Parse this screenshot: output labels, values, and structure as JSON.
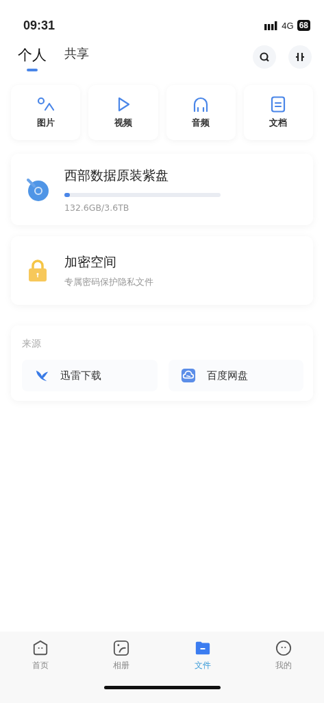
{
  "status_bar": {
    "time": "09:31",
    "network": "4G",
    "battery": "68"
  },
  "tabs": [
    {
      "label": "个人",
      "selected": true
    },
    {
      "label": "共享",
      "selected": false
    }
  ],
  "categories": [
    {
      "kind": "picture",
      "label": "图片"
    },
    {
      "kind": "video",
      "label": "视频"
    },
    {
      "kind": "audio",
      "label": "音频"
    },
    {
      "kind": "document",
      "label": "文档"
    }
  ],
  "drive": {
    "name": "西部数据原装紫盘",
    "level": 0.036,
    "usage": "132.6GB/3.6TB"
  },
  "vault": {
    "title": "加密空间",
    "subtitle": "专属密码保护隐私文件"
  },
  "sources": {
    "title": "来源",
    "items": [
      {
        "kind": "xunlei",
        "label": "迅雷下载"
      },
      {
        "kind": "baidu",
        "label": "百度网盘"
      }
    ]
  },
  "nav": [
    {
      "kind": "home",
      "label": "首页",
      "selected": false
    },
    {
      "kind": "album",
      "label": "相册",
      "selected": false
    },
    {
      "kind": "files",
      "label": "文件",
      "selected": true
    },
    {
      "kind": "mine",
      "label": "我的",
      "selected": false
    }
  ]
}
